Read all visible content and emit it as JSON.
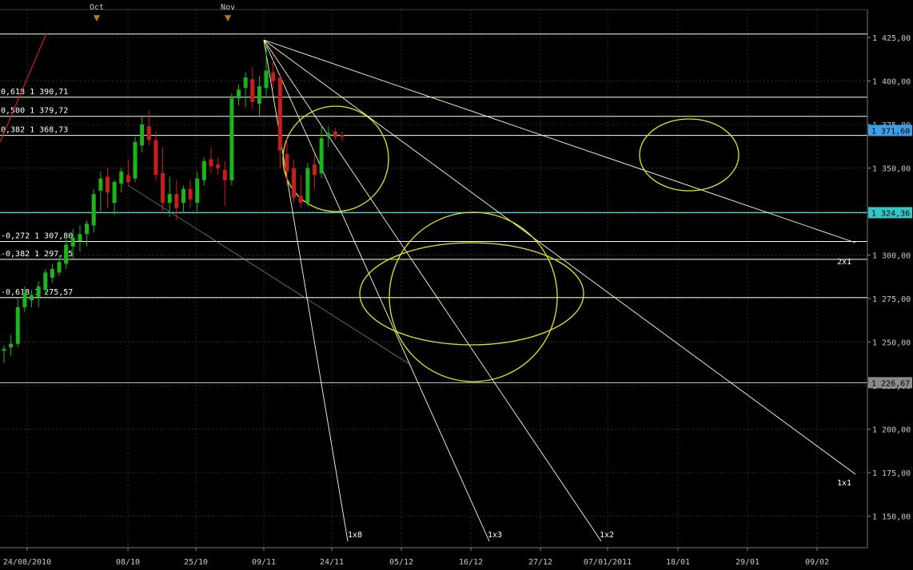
{
  "chart_data": {
    "type": "candlestick",
    "ylim": [
      1140,
      1437
    ],
    "y_ticks": [
      "1 425,00",
      "1 400,00",
      "1 375,00",
      "1 350,00",
      "1 325,00",
      "1 300,00",
      "1 275,00",
      "1 250,00",
      "1 225,00",
      "1 200,00",
      "1 175,00",
      "1 150,00"
    ],
    "y_tick_values": [
      1425,
      1400,
      1375,
      1350,
      1325,
      1300,
      1275,
      1250,
      1225,
      1200,
      1175,
      1150
    ],
    "x_ticks": [
      "24/08/2010",
      "08/10",
      "25/10",
      "09/11",
      "24/11",
      "05/12",
      "16/12",
      "27/12",
      "07/01/2011",
      "18/01",
      "29/01",
      "09/02"
    ],
    "month_markers": [
      "Oct",
      "Nov"
    ],
    "candles": [
      {
        "o": 1245,
        "h": 1248,
        "l": 1238,
        "c": 1246
      },
      {
        "o": 1247,
        "h": 1254,
        "l": 1242,
        "c": 1249
      },
      {
        "o": 1249,
        "h": 1275,
        "l": 1247,
        "c": 1270
      },
      {
        "o": 1270,
        "h": 1282,
        "l": 1267,
        "c": 1278
      },
      {
        "o": 1274,
        "h": 1280,
        "l": 1270,
        "c": 1277
      },
      {
        "o": 1276,
        "h": 1285,
        "l": 1270,
        "c": 1282
      },
      {
        "o": 1280,
        "h": 1292,
        "l": 1277,
        "c": 1290
      },
      {
        "o": 1287,
        "h": 1295,
        "l": 1284,
        "c": 1292
      },
      {
        "o": 1290,
        "h": 1300,
        "l": 1288,
        "c": 1296
      },
      {
        "o": 1295,
        "h": 1310,
        "l": 1292,
        "c": 1306
      },
      {
        "o": 1305,
        "h": 1315,
        "l": 1298,
        "c": 1310
      },
      {
        "o": 1308,
        "h": 1317,
        "l": 1302,
        "c": 1312
      },
      {
        "o": 1312,
        "h": 1320,
        "l": 1305,
        "c": 1318
      },
      {
        "o": 1317,
        "h": 1338,
        "l": 1313,
        "c": 1335
      },
      {
        "o": 1337,
        "h": 1348,
        "l": 1325,
        "c": 1344
      },
      {
        "o": 1345,
        "h": 1350,
        "l": 1327,
        "c": 1336
      },
      {
        "o": 1330,
        "h": 1343,
        "l": 1323,
        "c": 1342
      },
      {
        "o": 1341,
        "h": 1350,
        "l": 1336,
        "c": 1348
      },
      {
        "o": 1346,
        "h": 1355,
        "l": 1340,
        "c": 1342
      },
      {
        "o": 1344,
        "h": 1368,
        "l": 1342,
        "c": 1365
      },
      {
        "o": 1363,
        "h": 1380,
        "l": 1359,
        "c": 1375
      },
      {
        "o": 1374,
        "h": 1383,
        "l": 1363,
        "c": 1366
      },
      {
        "o": 1366,
        "h": 1371,
        "l": 1343,
        "c": 1346
      },
      {
        "o": 1347,
        "h": 1362,
        "l": 1325,
        "c": 1330
      },
      {
        "o": 1330,
        "h": 1345,
        "l": 1322,
        "c": 1335
      },
      {
        "o": 1335,
        "h": 1343,
        "l": 1320,
        "c": 1327
      },
      {
        "o": 1330,
        "h": 1340,
        "l": 1324,
        "c": 1338
      },
      {
        "o": 1338,
        "h": 1343,
        "l": 1327,
        "c": 1332
      },
      {
        "o": 1330,
        "h": 1348,
        "l": 1325,
        "c": 1344
      },
      {
        "o": 1343,
        "h": 1356,
        "l": 1340,
        "c": 1354
      },
      {
        "o": 1355,
        "h": 1362,
        "l": 1347,
        "c": 1351
      },
      {
        "o": 1352,
        "h": 1356,
        "l": 1346,
        "c": 1350
      },
      {
        "o": 1349,
        "h": 1354,
        "l": 1328,
        "c": 1343
      },
      {
        "o": 1343,
        "h": 1393,
        "l": 1340,
        "c": 1390
      },
      {
        "o": 1390,
        "h": 1398,
        "l": 1386,
        "c": 1395
      },
      {
        "o": 1396,
        "h": 1405,
        "l": 1385,
        "c": 1402
      },
      {
        "o": 1401,
        "h": 1408,
        "l": 1384,
        "c": 1388
      },
      {
        "o": 1387,
        "h": 1403,
        "l": 1380,
        "c": 1397
      },
      {
        "o": 1396,
        "h": 1422,
        "l": 1390,
        "c": 1406
      },
      {
        "o": 1405,
        "h": 1412,
        "l": 1395,
        "c": 1400
      },
      {
        "o": 1402,
        "h": 1404,
        "l": 1350,
        "c": 1360
      },
      {
        "o": 1358,
        "h": 1367,
        "l": 1340,
        "c": 1348
      },
      {
        "o": 1350,
        "h": 1355,
        "l": 1330,
        "c": 1333
      },
      {
        "o": 1334,
        "h": 1346,
        "l": 1327,
        "c": 1330
      },
      {
        "o": 1330,
        "h": 1353,
        "l": 1328,
        "c": 1350
      },
      {
        "o": 1352,
        "h": 1358,
        "l": 1338,
        "c": 1346
      },
      {
        "o": 1347,
        "h": 1375,
        "l": 1344,
        "c": 1367
      },
      {
        "o": 1368,
        "h": 1374,
        "l": 1362,
        "c": 1370
      },
      {
        "o": 1371,
        "h": 1373,
        "l": 1366,
        "c": 1368
      },
      {
        "o": 1369,
        "h": 1371,
        "l": 1365,
        "c": 1368
      }
    ],
    "fib_levels": [
      {
        "label": "0,618 1 390,71",
        "value": 1390.71
      },
      {
        "label": "0,500 1 379,72",
        "value": 1379.72
      },
      {
        "label": "0,382 1 368,73",
        "value": 1368.73
      },
      {
        "label": "-0,272 1 307,80",
        "value": 1307.8
      },
      {
        "label": "-0,382 1 297,55",
        "value": 1297.55
      },
      {
        "label": "-0,618 1 275,57",
        "value": 1275.57
      }
    ],
    "top_line": 1427,
    "support_line": 1226.67,
    "cyan_line": 1324.36,
    "price_boxes": [
      {
        "label": "1 371,60",
        "value": 1371.6,
        "color": "#3aa0e8"
      },
      {
        "label": "1 324,36",
        "value": 1324.36,
        "color": "#34c6c6"
      },
      {
        "label": "1 226,67",
        "value": 1226.67,
        "color": "#8a8a8a"
      }
    ],
    "fan_labels": [
      "1x8",
      "1x3",
      "1x2",
      "2x1",
      "1x1"
    ],
    "colors": {
      "up": "#1bb51b",
      "down": "#c81d1d",
      "level": "#ffffd0",
      "ellipse": "#e6e61a",
      "cyan": "#40e0e0"
    }
  }
}
